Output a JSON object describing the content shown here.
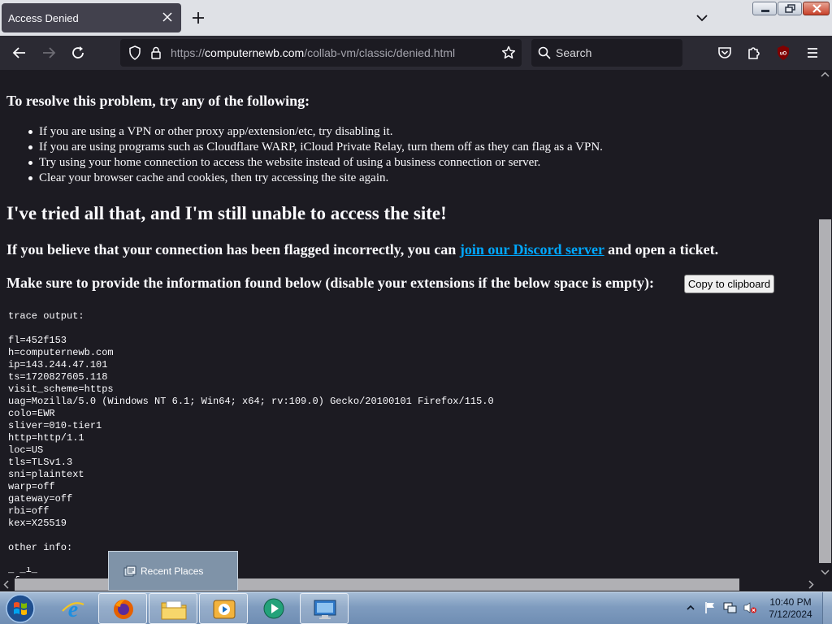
{
  "browser": {
    "tab_title": "Access Denied",
    "url_domain": "computernewb.com",
    "url_prefix": "https://",
    "url_path": "/collab-vm/classic/denied.html",
    "search_placeholder": "Search"
  },
  "page": {
    "resolve_heading": "To resolve this problem, try any of the following:",
    "tips": [
      "If you are using a VPN or other proxy app/extension/etc, try disabling it.",
      "If you are using programs such as Cloudflare WARP, iCloud Private Relay, turn them off as they can flag as a VPN.",
      "Try using your home connection to access the website instead of using a business connection or server.",
      "Clear your browser cache and cookies, then try accessing the site again."
    ],
    "tried_heading": "I've tried all that, and I'm still unable to access the site!",
    "flagged_before": "If you believe that your connection has been flagged incorrectly, you can ",
    "flagged_link": "join our Discord server",
    "flagged_after": " and open a ticket.",
    "info_text": "Make sure to provide the information found below (disable your extensions if the below space is empty):",
    "copy_button": "Copy to clipboard",
    "trace_lines": [
      "trace output:",
      "",
      "fl=452f153",
      "h=computernewb.com",
      "ip=143.244.47.101",
      "ts=1720827605.118",
      "visit_scheme=https",
      "uag=Mozilla/5.0 (Windows NT 6.1; Win64; x64; rv:109.0) Gecko/20100101 Firefox/115.0",
      "colo=EWR",
      "sliver=010-tier1",
      "http=http/1.1",
      "loc=US",
      "tls=TLSv1.3",
      "sni=plaintext",
      "warp=off",
      "gateway=off",
      "rbi=off",
      "kex=X25519",
      "",
      "other info:"
    ]
  },
  "popup": {
    "label": "Recent Places"
  },
  "taskbar": {
    "apps": [
      "internet-explorer",
      "firefox",
      "file-explorer",
      "media-player",
      "media-center",
      "remote-desktop"
    ],
    "time": "10:40 PM",
    "date": "7/12/2024"
  },
  "colors": {
    "page_bg": "#1c1b22",
    "link": "#00a8ff",
    "toolbar_bg": "#2b2a33",
    "tabbar_bg": "#dfe1e6"
  }
}
